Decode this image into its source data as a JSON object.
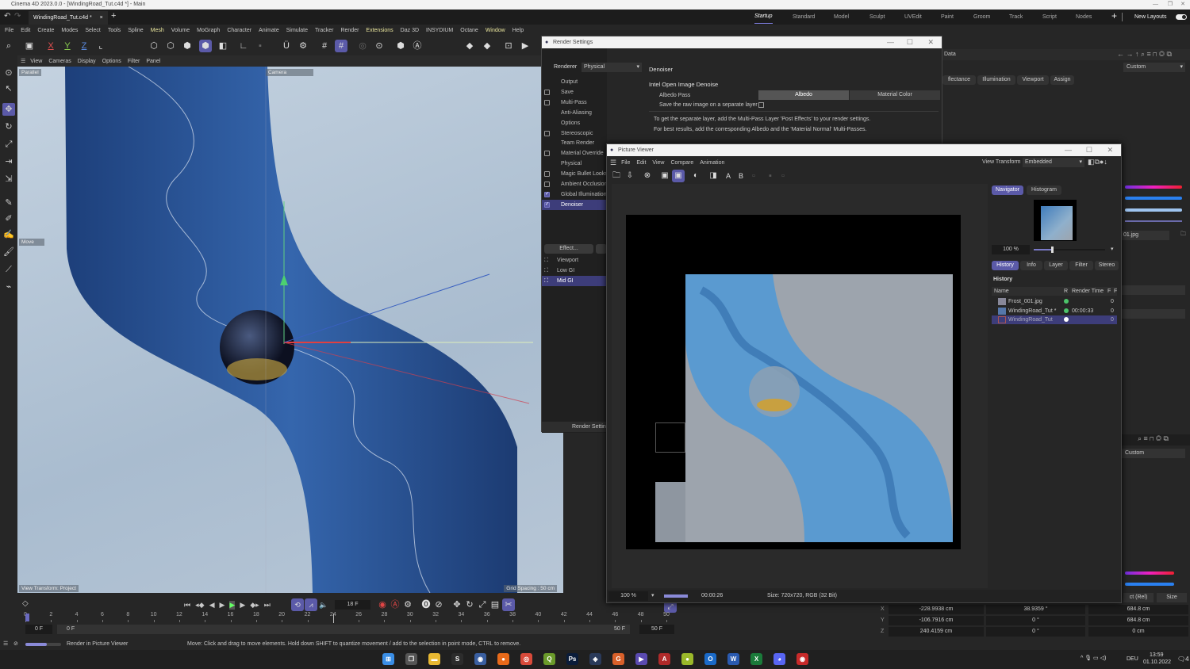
{
  "window": {
    "title": "Cinema 4D 2023.0.0 - [WindingRoad_Tut.c4d *] - Main"
  },
  "doc_tab": {
    "label": "WindingRoad_Tut.c4d *",
    "close": "×",
    "add": "+"
  },
  "layouts": {
    "tabs": [
      "Startup",
      "Standard",
      "Model",
      "Sculpt",
      "UVEdit",
      "Paint",
      "Groom",
      "Track",
      "Script",
      "Nodes"
    ],
    "active": "Startup",
    "add": "+",
    "new_layouts": "New Layouts"
  },
  "menu": [
    "File",
    "Edit",
    "Create",
    "Modes",
    "Select",
    "Tools",
    "Spline",
    "Mesh",
    "Volume",
    "MoGraph",
    "Character",
    "Animate",
    "Simulate",
    "Tracker",
    "Render",
    "Extensions",
    "Daz 3D",
    "INSYDIUM",
    "Octane",
    "Window",
    "Help"
  ],
  "menu_highlighted": [
    "Mesh",
    "Extensions",
    "Window"
  ],
  "axis_buttons": [
    "X",
    "Y",
    "Z"
  ],
  "viewport": {
    "menu": [
      "View",
      "Cameras",
      "Display",
      "Options",
      "Filter",
      "Panel"
    ],
    "label_projection": "Parallel",
    "label_camera": "Camera",
    "label_tool": "Move",
    "view_transform": "View Transform: Project",
    "grid_spacing": "Grid Spacing : 50 cm"
  },
  "render_settings": {
    "title": "Render Settings",
    "renderer_label": "Renderer",
    "renderer_value": "Physical",
    "items": [
      {
        "label": "Output",
        "checkbox": null
      },
      {
        "label": "Save",
        "checkbox": false
      },
      {
        "label": "Multi-Pass",
        "checkbox": false
      },
      {
        "label": "Anti-Aliasing",
        "checkbox": null
      },
      {
        "label": "Options",
        "checkbox": null
      },
      {
        "label": "Stereoscopic",
        "checkbox": false
      },
      {
        "label": "Team Render",
        "checkbox": null
      },
      {
        "label": "Material Override",
        "checkbox": false
      },
      {
        "label": "Physical",
        "checkbox": null
      },
      {
        "label": "Magic Bullet Looks",
        "checkbox": false
      },
      {
        "label": "Ambient Occlusion",
        "checkbox": false
      },
      {
        "label": "Global Illumination",
        "checkbox": true
      },
      {
        "label": "Denoiser",
        "checkbox": true,
        "selected": true
      }
    ],
    "effect_button": "Effect...",
    "presets": [
      {
        "label": "Viewport"
      },
      {
        "label": "Low GI"
      },
      {
        "label": "Mid GI",
        "selected": true
      }
    ],
    "footer_button": "Render Setting",
    "section_title": "Denoiser",
    "subsection": "Intel Open Image Denoise",
    "albedo_label": "Albedo Pass",
    "albedo_options": [
      "Albedo",
      "Material Color"
    ],
    "albedo_selected": "Albedo",
    "raw_label": "Save the raw image on a separate layer",
    "info1": "To get the separate layer, add the Multi-Pass Layer 'Post Effects' to your render settings.",
    "info2": "For best results, add the corresponding Albedo and the 'Material Normal' Multi-Passes."
  },
  "attributes": {
    "header": "Data",
    "tabs": [
      "flectance",
      "Illumination",
      "Viewport",
      "Assign"
    ],
    "mode": "Custom",
    "file_fragment": "01.jpg",
    "mode2": "Custom",
    "coord_mode": "ct (Rel)",
    "size_mode": "Size"
  },
  "picture_viewer": {
    "title": "Picture Viewer",
    "menu": [
      "File",
      "Edit",
      "View",
      "Compare",
      "Animation"
    ],
    "view_transform_label": "View Transform",
    "view_transform_value": "Embedded",
    "toolbar_letters": [
      "A",
      "B"
    ],
    "side_tabs": [
      "Navigator",
      "Histogram"
    ],
    "side_tabs_active": "Navigator",
    "nav_zoom": "100 %",
    "info_tabs": [
      "History",
      "Info",
      "Layer",
      "Filter",
      "Stereo"
    ],
    "info_tabs_active": "History",
    "history_title": "History",
    "history_columns": [
      "Name",
      "R",
      "Render Time",
      "F",
      "F"
    ],
    "history_rows": [
      {
        "name": "Frost_001.jpg",
        "status": "#4cc36a",
        "time": "",
        "frame": "0"
      },
      {
        "name": "WindingRoad_Tut *",
        "status": "#4cc36a",
        "time": "00:00:33",
        "frame": "0"
      },
      {
        "name": "WindingRoad_Tut",
        "status": "#ffffff",
        "time": "",
        "frame": "0",
        "selected": true
      }
    ],
    "zoom": "100 %",
    "progress": 1.0,
    "time": "00:00:26",
    "size_info": "Size: 720x720, RGB (32 Bit)"
  },
  "timeline": {
    "current_frame": "18 F",
    "ticks": [
      "0",
      "2",
      "4",
      "6",
      "8",
      "10",
      "12",
      "14",
      "16",
      "18",
      "20",
      "22",
      "24",
      "26",
      "28",
      "30",
      "32",
      "34",
      "36",
      "38",
      "40",
      "42",
      "44",
      "46",
      "48",
      "50"
    ],
    "start": "0 F",
    "range_start": "0 F",
    "range_end": "50 F",
    "end": "50 F"
  },
  "coordinates": {
    "rows": [
      {
        "axis": "X",
        "pos": "-228.9938 cm",
        "rot": "38.9359 °",
        "size": "684.8 cm"
      },
      {
        "axis": "Y",
        "pos": "-106.7916 cm",
        "rot": "0 °",
        "size": "684.8 cm"
      },
      {
        "axis": "Z",
        "pos": "240.4159 cm",
        "rot": "0 °",
        "size": "0 cm"
      }
    ]
  },
  "status": {
    "render_label": "Render in Picture Viewer",
    "render_progress": 0.6,
    "hint": "Move: Click and drag to move elements. Hold down SHIFT to quantize movement / add to the selection in point mode, CTRL to remove."
  },
  "taskbar": {
    "apps": [
      {
        "name": "start",
        "color": "#3a8ee6",
        "glyph": "⊞"
      },
      {
        "name": "task-view",
        "color": "#555",
        "glyph": "❐"
      },
      {
        "name": "file-explorer",
        "color": "#e8b832",
        "glyph": "▬"
      },
      {
        "name": "s-app",
        "color": "#2c2c2c",
        "glyph": "S"
      },
      {
        "name": "cinema4d",
        "color": "#3a5fa0",
        "glyph": "◉"
      },
      {
        "name": "firefox",
        "color": "#e86a1a",
        "glyph": "●"
      },
      {
        "name": "chrome",
        "color": "#d84a3a",
        "glyph": "◎"
      },
      {
        "name": "app-q",
        "color": "#6a9a2a",
        "glyph": "Q"
      },
      {
        "name": "photoshop",
        "color": "#0a1c3a",
        "glyph": "Ps"
      },
      {
        "name": "davinci",
        "color": "#2a3a5a",
        "glyph": "◈"
      },
      {
        "name": "app-g",
        "color": "#d8602a",
        "glyph": "G"
      },
      {
        "name": "app-arrow",
        "color": "#5a4ab0",
        "glyph": "▶"
      },
      {
        "name": "access",
        "color": "#b02a2a",
        "glyph": "A"
      },
      {
        "name": "app-green",
        "color": "#9ab82a",
        "glyph": "●"
      },
      {
        "name": "outlook",
        "color": "#1a6ac8",
        "glyph": "O"
      },
      {
        "name": "word",
        "color": "#2a5ab0",
        "glyph": "W"
      },
      {
        "name": "excel",
        "color": "#1a7a3a",
        "glyph": "X"
      },
      {
        "name": "discord",
        "color": "#5865f2",
        "glyph": "◕"
      },
      {
        "name": "record",
        "color": "#c82a2a",
        "glyph": "◉"
      }
    ],
    "language": "DEU",
    "time": "13:59",
    "date": "01.10.2022",
    "notifications": "4"
  },
  "colors": {
    "accent": "#5b5aa8",
    "selection": "#3d3d7a",
    "model_blue": "#2f5a9c",
    "render_blue": "#6fa8d6"
  }
}
